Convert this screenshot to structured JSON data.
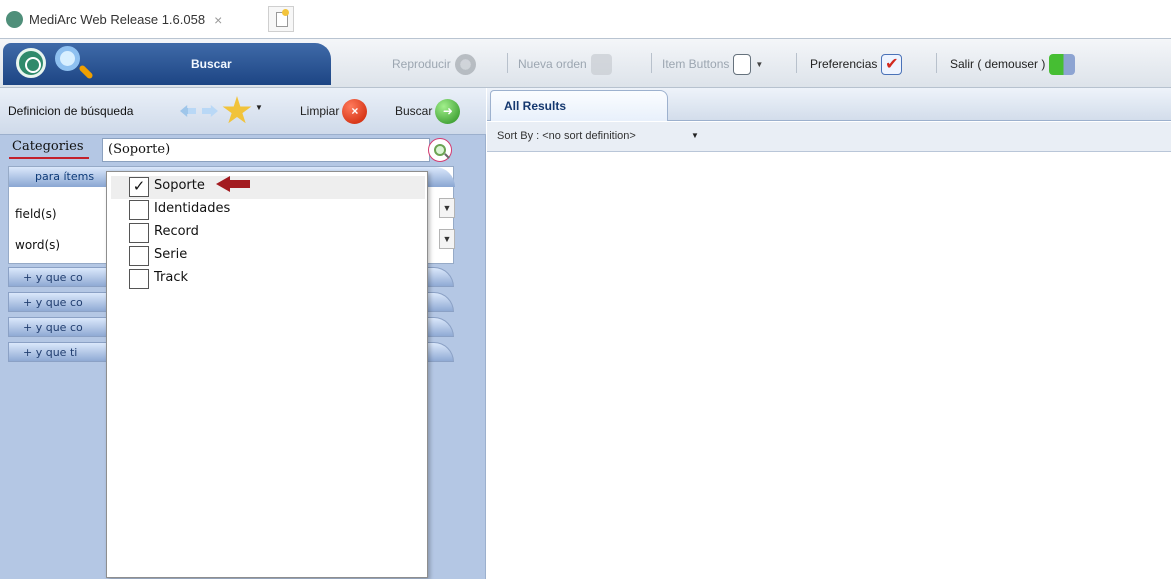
{
  "browser": {
    "tab_title": "MediArc Web Release 1.6.058",
    "close_glyph": "×",
    "icons": {
      "favicon": "mediarc-globe-icon",
      "close": "close-icon",
      "new_tab": "new-tab-icon"
    }
  },
  "toolbar": {
    "search_tab_label": "Buscar",
    "play_label": "Reproducir",
    "new_order_label": "Nueva orden",
    "item_buttons_label": "Item Buttons",
    "preferences_label": "Preferencias",
    "exit_label": "Salir ( demouser )",
    "icons": {
      "logo": "globe-logo-icon",
      "search": "search-icon",
      "play": "speaker-icon",
      "order": "order-icon",
      "item_buttons": "item-buttons-icon",
      "preferences": "checklist-icon",
      "exit": "exit-door-icon"
    }
  },
  "search_panel": {
    "title": "Definicion de búsqueda",
    "clear_label": "Limpiar",
    "search_label": "Buscar",
    "categories_label": "Categories",
    "categories_value": "(Soporte)",
    "criteria_title": "para ítems",
    "fields_label": "field(s)",
    "words_label": "word(s)",
    "condition_rows": [
      "+ y que co",
      "+ y que co",
      "+ y que co",
      "+ y que ti"
    ],
    "icons": {
      "back": "left-arrow-icon",
      "forward": "right-arrow-icon",
      "favorites": "star-icon",
      "clear": "clear-icon",
      "run_search": "go-arrow-icon",
      "lookup": "zoom-icon",
      "annotation": "red-arrow-icon"
    },
    "annotation_color": "#a31b20"
  },
  "category_dropdown": {
    "items": [
      {
        "label": "Soporte",
        "checked": true
      },
      {
        "label": "Identidades",
        "checked": false
      },
      {
        "label": "Record",
        "checked": false
      },
      {
        "label": "Serie",
        "checked": false
      },
      {
        "label": "Track",
        "checked": false
      }
    ]
  },
  "results": {
    "tab_label": "All Results",
    "sort_label": "Sort By : <no sort definition>"
  }
}
